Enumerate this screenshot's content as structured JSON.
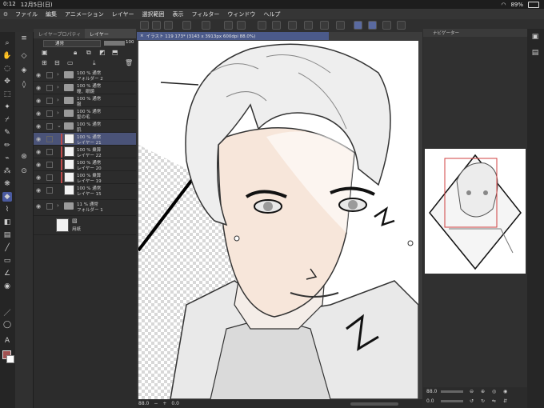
{
  "status_bar": {
    "time": "0:12",
    "date": "12月5日(日)",
    "battery": "89%"
  },
  "menu": [
    "ファイル",
    "編集",
    "アニメーション",
    "レイヤー",
    "選択範囲",
    "表示",
    "フィルター",
    "ウィンドウ",
    "ヘルプ"
  ],
  "layer_panel": {
    "tabs": [
      "レイヤープロパティ",
      "レイヤー"
    ],
    "blend_mode": "通常",
    "opacity": "100",
    "layers": [
      {
        "line1": "100 % 通常",
        "line2": "フォルダー 2",
        "kind": "folder"
      },
      {
        "line1": "100 % 通常",
        "line2": "瞳、眼鏡",
        "kind": "folder"
      },
      {
        "line1": "100 % 通常",
        "line2": "服",
        "kind": "folder"
      },
      {
        "line1": "100 % 通常",
        "line2": "髪の毛",
        "kind": "folder"
      },
      {
        "line1": "100 % 通常",
        "line2": "肌",
        "kind": "folder"
      },
      {
        "line1": "100 % 通常",
        "line2": "レイヤー 21",
        "kind": "layer",
        "selected": true
      },
      {
        "line1": "100 % 乗算",
        "line2": "レイヤー 22",
        "kind": "layer"
      },
      {
        "line1": "100 % 通常",
        "line2": "レイヤー 20",
        "kind": "layer"
      },
      {
        "line1": "100 % 乗算",
        "line2": "レイヤー 19",
        "kind": "layer"
      },
      {
        "line1": "100 % 通常",
        "line2": "レイヤー 15",
        "kind": "layer"
      },
      {
        "line1": "11 % 通常",
        "line2": "フォルダー 1",
        "kind": "folder"
      },
      {
        "line1": "",
        "line2": "用紙",
        "kind": "paper"
      }
    ]
  },
  "document": {
    "tab_label": "イラスト 119 173* (3143 x 3913px 600dpi 88.0%)"
  },
  "bottom_bar": {
    "zoom": "88.0",
    "rotation": "0.0"
  },
  "navigator": {
    "title": "ナビゲーター",
    "zoom": "88.0",
    "rotation": "0.0"
  },
  "colors": {
    "accent": "#4b5a8a",
    "main_color": "#a05050",
    "sub_color": "#ffffff"
  }
}
